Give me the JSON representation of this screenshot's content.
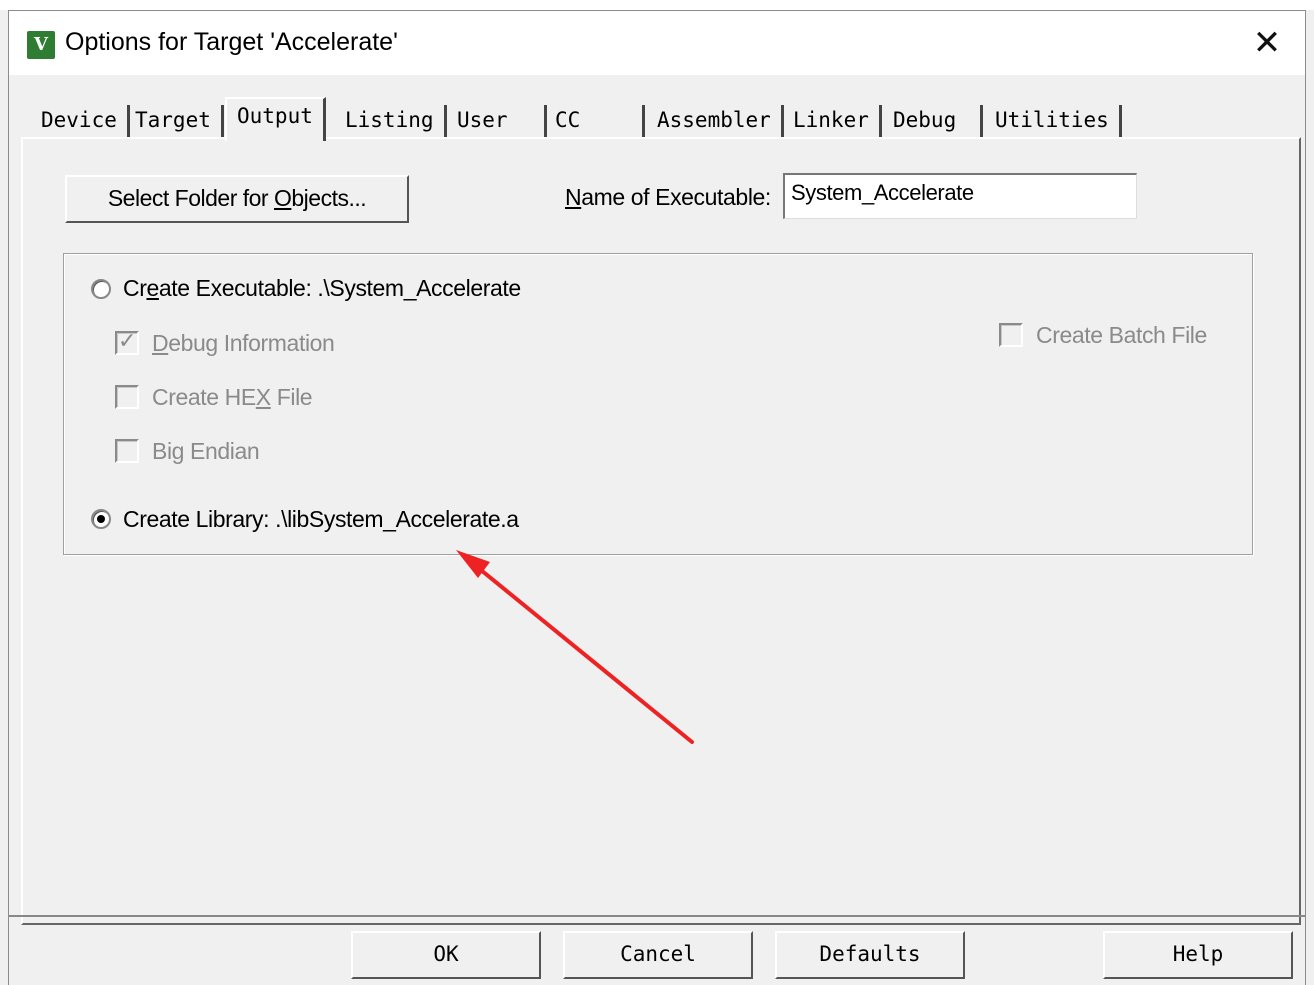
{
  "window": {
    "title": "Options for Target 'Accelerate'",
    "icon": "µVision-icon",
    "close_glyph": "✕"
  },
  "tabs": [
    {
      "label": "Device",
      "active": false
    },
    {
      "label": "Target",
      "active": false
    },
    {
      "label": "Output",
      "active": true
    },
    {
      "label": "Listing",
      "active": false
    },
    {
      "label": "User",
      "active": false
    },
    {
      "label": "CC",
      "active": false
    },
    {
      "label": "Assembler",
      "active": false
    },
    {
      "label": "Linker",
      "active": false
    },
    {
      "label": "Debug",
      "active": false
    },
    {
      "label": "Utilities",
      "active": false
    }
  ],
  "output": {
    "select_folder_button": {
      "pre": "Select Folder for ",
      "hot": "O",
      "post": "bjects..."
    },
    "name_of_executable_label": {
      "hot": "N",
      "post": "ame of Executable:"
    },
    "name_of_executable_value": "System_Accelerate",
    "create_executable": {
      "pre": "Cr",
      "hot": "e",
      "post": "ate Executable:  .\\System_Accelerate",
      "selected": false
    },
    "debug_information": {
      "hot": "D",
      "post": "ebug Information",
      "checked": true,
      "enabled": false
    },
    "create_hex_file": {
      "pre": "Create HE",
      "hot": "X",
      "post": " File",
      "checked": false,
      "enabled": false
    },
    "big_endian": {
      "pre": "Bi",
      "hot": "g",
      "post": " Endian",
      "checked": false,
      "enabled": false
    },
    "create_batch_file": {
      "label": "Create Batch File",
      "checked": false,
      "enabled": false
    },
    "create_library": {
      "label": "Create Library:  .\\libSystem_Accelerate.a",
      "selected": true
    }
  },
  "footer": {
    "ok": "OK",
    "cancel": "Cancel",
    "defaults": "Defaults",
    "help": "Help"
  },
  "annotation": {
    "arrow_color": "#ee2222"
  }
}
